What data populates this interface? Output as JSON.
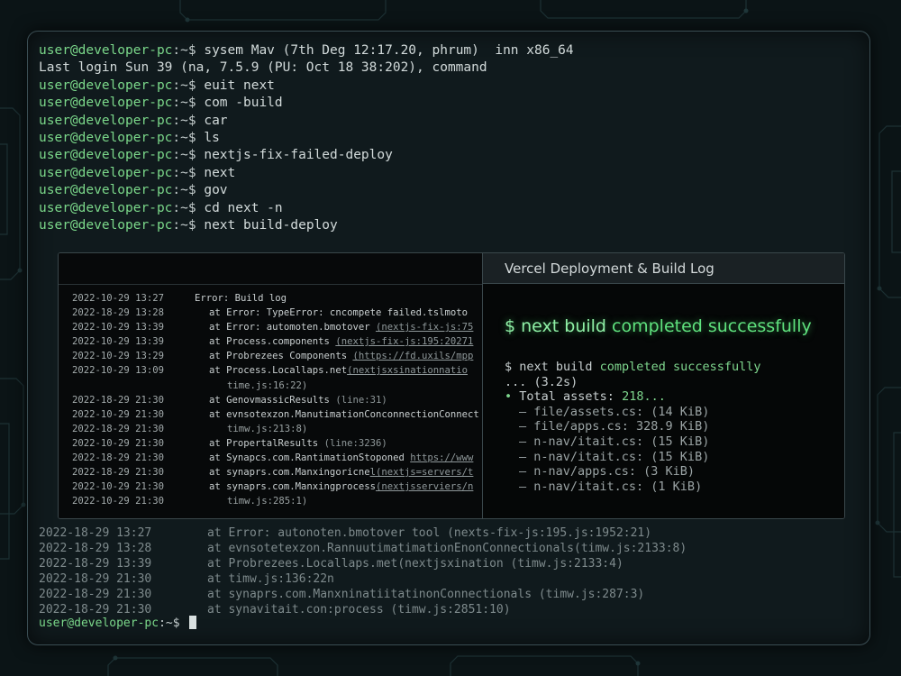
{
  "terminal": {
    "prompt_user": "user@developer-pc",
    "prompt_sym": ":~$",
    "lines": [
      {
        "type": "prompt",
        "cmd": " sysem Mav (7th Deg 12:17.20, phrum)  inn x86_64"
      },
      {
        "type": "text",
        "text": "Last login Sun 39 (na, 7.5.9 (PU: Oct 18 38:202), command"
      },
      {
        "type": "prompt",
        "cmd": " euit next"
      },
      {
        "type": "prompt",
        "cmd": " com -build"
      },
      {
        "type": "prompt",
        "cmd": " car"
      },
      {
        "type": "prompt",
        "cmd": " ls"
      },
      {
        "type": "prompt",
        "cmd": " nextjs-fix-failed-deploy"
      },
      {
        "type": "prompt",
        "cmd": " next"
      },
      {
        "type": "prompt",
        "cmd": " gov"
      },
      {
        "type": "prompt",
        "cmd": " cd next -n"
      },
      {
        "type": "prompt",
        "cmd": " next build-deploy"
      }
    ],
    "dim_lines": [
      {
        "ts": "2022-18-29 13:27",
        "msg": "at Error: autonoten.bmotover tool (nexts-fix-js:195.js:1952:21)"
      },
      {
        "ts": "2022-18-29 13:28",
        "msg": "at evnsotetexzon.RannuutimatimationEnonConnectionals(timw.js:2133:8)"
      },
      {
        "ts": "2022-18-29 13:39",
        "msg": "at Probrezees.Locallaps.met(nextjsxination (timw.js:2133:4)"
      },
      {
        "ts": "2022-18-29 21:30",
        "msg": "at timw.js:136:22n"
      },
      {
        "ts": "2022-18-29 21:30",
        "msg": "at synaprs.com.Manxninatiitatinon​Connectionals (timw.js:287:3)"
      },
      {
        "ts": "2022-18-29 21:30",
        "msg": "at synavitait.con:process (timw.js:2851:10)"
      }
    ]
  },
  "build_log": {
    "rows": [
      {
        "ts": "2022-10-29 13:27",
        "msg": "Error: Build log",
        "indent": 0
      },
      {
        "ts": "2022-18-29 13:28",
        "msg": "at Error: TypeError: cncompete failed.tslmoto",
        "indent": 1
      },
      {
        "ts": "2022-10-29 13:39",
        "msg": "at Error: automoten.bmotover ",
        "link": "(nextjs-fix-js:75",
        "indent": 1
      },
      {
        "ts": "2022-10-29 13:39",
        "msg": "at Process.components ",
        "link": "(nextjs-fix-js:195:20271",
        "indent": 1
      },
      {
        "ts": "2022-10-29 13:29",
        "msg": "at Probrezees Components ",
        "link": "(https://fd.uxils/mpp",
        "indent": 1
      },
      {
        "ts": "2022-10-29 13:09",
        "msg": "at Process.Locallaps.net",
        "link": "(nextjsxsinationnatio",
        "indent": 1
      },
      {
        "ts": "",
        "msg": "time.js:16:22)",
        "indent": 2
      },
      {
        "ts": "2022-18-29 21:30",
        "msg": "at GenovmassicResults ",
        "dim": "(line:31)",
        "indent": 1
      },
      {
        "ts": "2022-10-29 21:30",
        "msg": "at evnsotexzon.ManutimationConconnectionConnect",
        "indent": 1
      },
      {
        "ts": "2022-18-29 21:30",
        "msg": "timw.js:213:8)",
        "indent": 2
      },
      {
        "ts": "2022-10-29 21:30",
        "msg": "at PropertalResults ",
        "dim": "(line:3236)",
        "indent": 1
      },
      {
        "ts": "2022-18-29 21:30",
        "msg": "at Synapcs.com.RantimationStoponed ",
        "link": "https://www",
        "indent": 1
      },
      {
        "ts": "2022-18-29 21:30",
        "msg": "at synaprs.com.Manxingoricne",
        "link": "l(nextjs=servers/t",
        "indent": 1
      },
      {
        "ts": "2022-10-29 21:30",
        "msg": "at synaprs.com.Manxingprocess",
        "link": "(nextjsserviers/n",
        "indent": 1
      },
      {
        "ts": "2022-10-29 21:30",
        "msg": "timw.js:285:1)",
        "indent": 2
      }
    ]
  },
  "deploy": {
    "title": "Vercel Deployment & Build Log",
    "headline_cmd": "$ next build",
    "headline_ok": " completed successfully",
    "line1_cmd": "$ next build ",
    "line1_ok": "completed successfully",
    "line2": "... (3.2s)",
    "bullet": "•",
    "total_label": " Total assets: ",
    "total_count": "218...",
    "assets": [
      "– file/assets.cs: (14 KiB)",
      "– file/apps.cs: 328.9 KiB)",
      "– n-nav/itait.cs: (15 KiB)",
      "– n-nav/itait.cs: (15 KiB)",
      "– n-nav/apps.cs: (3 KiB)",
      "– n-nav/itait.cs: (1 KiB)"
    ]
  },
  "colors": {
    "prompt_green": "#7bd88a",
    "success_green": "#5fe27e",
    "background": "#0b1416"
  }
}
